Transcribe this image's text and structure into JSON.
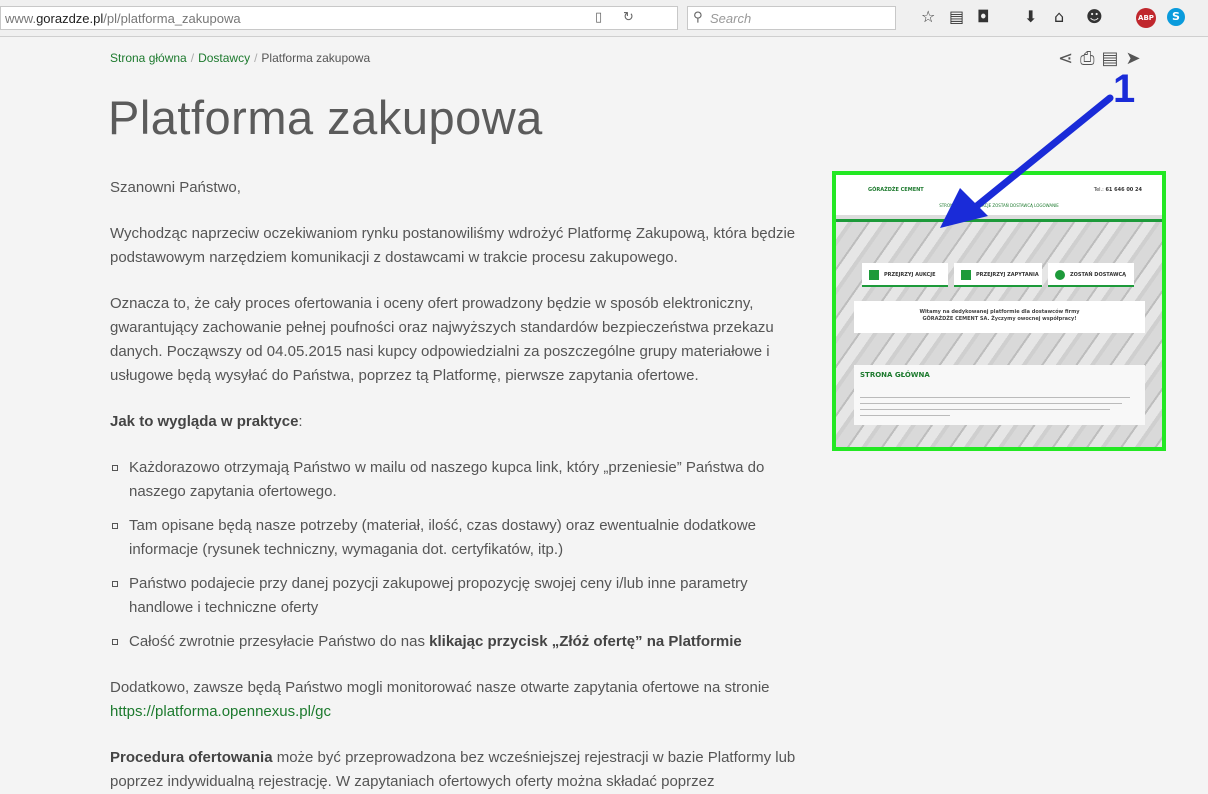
{
  "browser": {
    "url_domain_prefix": "www.",
    "url_domain": "gorazdze.pl",
    "url_path": "/pl/platforma_zakupowa",
    "search_placeholder": "Search",
    "abp_label": "ABP"
  },
  "breadcrumb": {
    "home": "Strona główna",
    "sep": "/",
    "suppliers": "Dostawcy",
    "current": "Platforma zakupowa"
  },
  "page": {
    "title": "Platforma zakupowa",
    "greeting": "Szanowni Państwo,",
    "para1": "Wychodząc naprzeciw oczekiwaniom rynku postanowiliśmy wdrożyć Platformę Zakupową, która będzie podstawowym narzędziem komunikacji z dostawcami w trakcie procesu zakupowego.",
    "para2": "Oznacza to, że cały proces ofertowania i oceny ofert prowadzony będzie w sposób elektroniczny, gwarantujący zachowanie pełnej poufności oraz najwyższych standardów bezpieczeństwa przekazu danych. Począwszy od 04.05.2015 nasi kupcy odpowiedzialni za poszczególne grupy materiałowe i usługowe będą wysyłać do Państwa, poprzez tą Platformę, pierwsze zapytania ofertowe.",
    "how_label": "Jak to wygląda w praktyce",
    "how_colon": ":",
    "bullets": [
      "Każdorazowo otrzymają Państwo w mailu od naszego kupca link, który „przeniesie” Państwa do naszego zapytania ofertowego.",
      "Tam opisane będą nasze potrzeby (materiał, ilość, czas dostawy) oraz ewentualnie dodatkowe informacje (rysunek techniczny, wymagania dot. certyfikatów, itp.)",
      "Państwo podajecie przy danej pozycji zakupowej propozycję swojej ceny i/lub inne parametry handlowe i techniczne oferty"
    ],
    "bullet4_text": "Całość zwrotnie przesyłacie Państwo do nas ",
    "bullet4_bold": "klikając przycisk „Złóż ofertę” na Platformie",
    "para3": "Dodatkowo, zawsze będą Państwo mogli monitorować nasze otwarte zapytania ofertowe na stronie ",
    "para3_link": "https://platforma.opennexus.pl/gc",
    "para4_bold": "Procedura ofertowania",
    "para4": " może być przeprowadzona bez wcześniejszej rejestracji w bazie Platformy lub poprzez indywidualną rejestrację. W zapytaniach ofertowych oferty można składać poprzez"
  },
  "thumbnail": {
    "logo": "GÓRAŻDŻE CEMENT",
    "tel_label": "Tel.:",
    "tel": "61 646 00 24",
    "nav": "STRONA GŁÓWNA     AUKCJE     ZOSTAŃ DOSTAWCĄ     LOGOWANIE",
    "btn_auctions": "PRZEJRZYJ AUKCJE",
    "btn_requests": "PRZEJRZYJ ZAPYTANIA",
    "btn_supplier": "ZOSTAŃ DOSTAWCĄ",
    "welcome_line1": "Witamy na dedykowanej platformie dla dostawców firmy",
    "welcome_line2": "GÓRAŻDŻE CEMENT SA. Życzymy owocnej współpracy!",
    "panel_title": "STRONA GŁÓWNA",
    "border_color": "#23e823"
  },
  "annotation": {
    "number": "1",
    "color": "#1a2bd8"
  },
  "colors": {
    "link_green": "#1d7a2e"
  }
}
